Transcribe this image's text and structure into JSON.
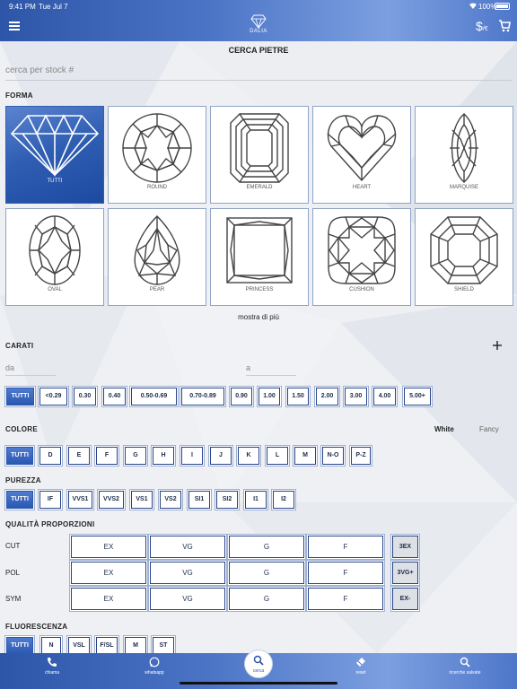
{
  "status_bar": {
    "time": "9:41 PM",
    "date": "Tue Jul 7",
    "battery": "100%"
  },
  "header": {
    "logo_text": "DALIA",
    "currency": "$",
    "currency_sub": "/€"
  },
  "page_title": "CERCA PIETRE",
  "search": {
    "placeholder": "cerca per stock #",
    "value": ""
  },
  "shape": {
    "title": "FORMA",
    "items": [
      {
        "label": "TUTTI",
        "icon": "diamond-icon",
        "selected": true
      },
      {
        "label": "ROUND",
        "icon": "round-cut-icon"
      },
      {
        "label": "EMERALD",
        "icon": "emerald-cut-icon"
      },
      {
        "label": "HEART",
        "icon": "heart-cut-icon"
      },
      {
        "label": "MARQUISE",
        "icon": "marquise-cut-icon"
      },
      {
        "label": "OVAL",
        "icon": "oval-cut-icon"
      },
      {
        "label": "PEAR",
        "icon": "pear-cut-icon"
      },
      {
        "label": "PRINCESS",
        "icon": "princess-cut-icon"
      },
      {
        "label": "CUSHION",
        "icon": "cushion-cut-icon"
      },
      {
        "label": "SHIELD",
        "icon": "shield-cut-icon"
      }
    ],
    "show_more": "mostra di più"
  },
  "carat": {
    "title": "CARATI",
    "from_placeholder": "da",
    "to_placeholder": "a",
    "chips": [
      "TUTTI",
      "<0.29",
      "0.30",
      "0.40",
      "0.50-0.69",
      "0.70-0.89",
      "0.90",
      "1.00",
      "1.50",
      "2.00",
      "3.00",
      "4.00",
      "5.00+"
    ]
  },
  "color": {
    "title": "COLORE",
    "mode_white": "White",
    "mode_fancy": "Fancy",
    "chips": [
      "TUTTI",
      "D",
      "E",
      "F",
      "G",
      "H",
      "I",
      "J",
      "K",
      "L",
      "M",
      "N-O",
      "P-Z"
    ]
  },
  "clarity": {
    "title": "PUREZZA",
    "chips": [
      "TUTTI",
      "IF",
      "VVS1",
      "VVS2",
      "VS1",
      "VS2",
      "SI1",
      "SI2",
      "I1",
      "I2"
    ]
  },
  "proportions": {
    "title": "QUALITÀ PROPORZIONI",
    "rows": [
      {
        "label": "CUT",
        "grades": [
          "EX",
          "VG",
          "G",
          "F"
        ],
        "preset": "3EX"
      },
      {
        "label": "POL",
        "grades": [
          "EX",
          "VG",
          "G",
          "F"
        ],
        "preset": "3VG+"
      },
      {
        "label": "SYM",
        "grades": [
          "EX",
          "VG",
          "G",
          "F"
        ],
        "preset": "EX-"
      }
    ]
  },
  "fluorescence": {
    "title": "FLUORESCENZA",
    "chips": [
      "TUTTI",
      "N",
      "VSL",
      "F/SL",
      "M",
      "ST"
    ]
  },
  "tab_bar": {
    "items": [
      {
        "label": "chiama",
        "icon": "phone-icon"
      },
      {
        "label": "whatsapp",
        "icon": "whatsapp-icon"
      },
      {
        "label": "cerca",
        "icon": "search-icon"
      },
      {
        "label": "reset",
        "icon": "eraser-icon"
      },
      {
        "label": "ricerche salvate",
        "icon": "saved-search-icon"
      }
    ]
  }
}
